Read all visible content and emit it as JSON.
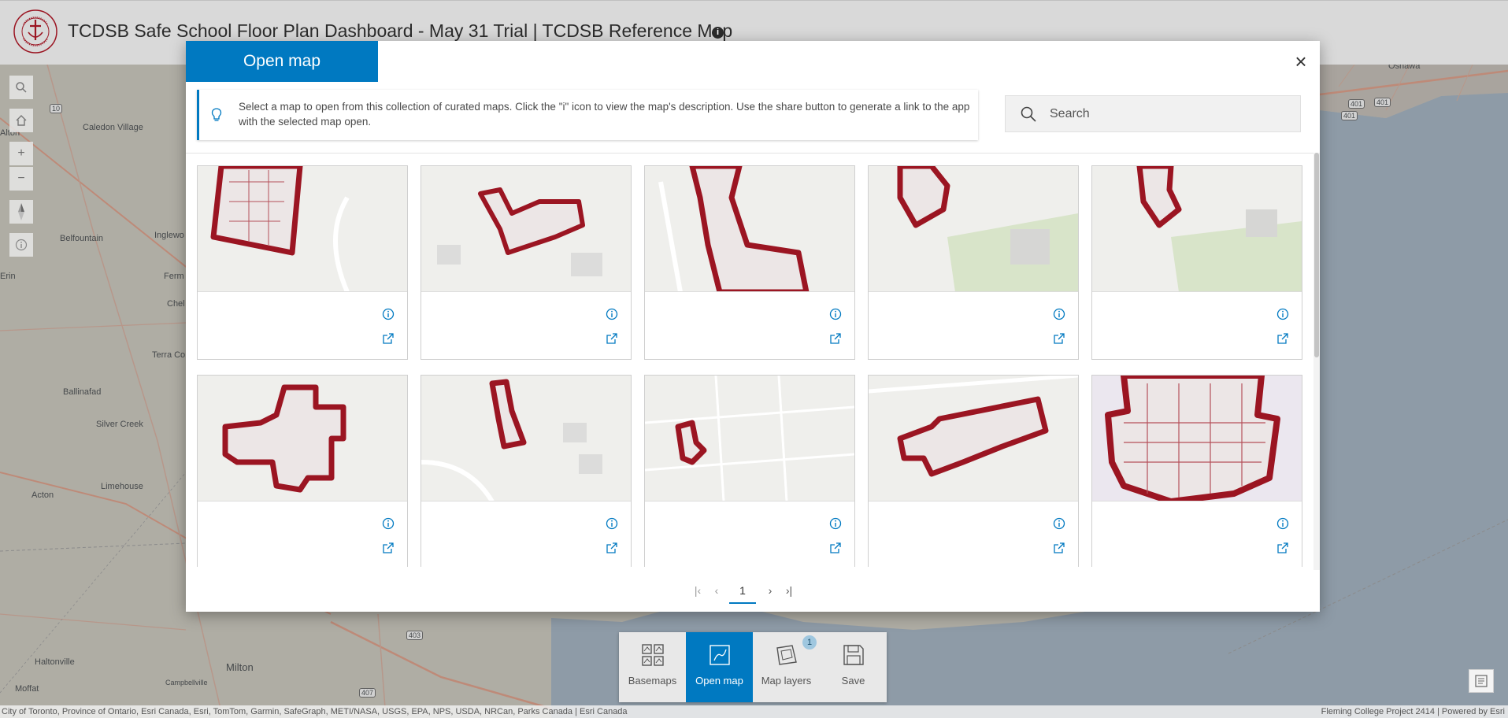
{
  "header": {
    "title": "TCDSB Safe School Floor Plan Dashboard - May 31 Trial | TCDSB Reference Map",
    "info_icon": "info-icon",
    "logo_text_top": "Toronto Catholic",
    "logo_text_bottom": "District School Board"
  },
  "map": {
    "labels": [
      {
        "text": "Oshawa"
      },
      {
        "text": "Caledon Village"
      },
      {
        "text": "Alton"
      },
      {
        "text": "Belfountain"
      },
      {
        "text": "Inglewo"
      },
      {
        "text": "Erin"
      },
      {
        "text": "Ferm"
      },
      {
        "text": "Chel"
      },
      {
        "text": "Terra Co"
      },
      {
        "text": "Ballinafad"
      },
      {
        "text": "Silver Creek"
      },
      {
        "text": "Acton"
      },
      {
        "text": "Limehouse"
      },
      {
        "text": "Haltonville"
      },
      {
        "text": "Milton"
      },
      {
        "text": "Moffat"
      },
      {
        "text": "Campbellville"
      }
    ],
    "shields": [
      "10",
      "401",
      "401",
      "401",
      "403",
      "407"
    ],
    "tools": [
      "search-icon",
      "home-icon",
      "zoom-in-icon",
      "zoom-out-icon",
      "compass-icon",
      "info-icon"
    ]
  },
  "modal": {
    "tab_label": "Open map",
    "close_icon": "close-icon",
    "notice": "Select a map to open from this collection of curated maps. Click the \"i\" icon to view the map's description. Use the share button to generate a link to the app with the selected map open.",
    "search_placeholder": "Search",
    "cards": [
      {
        "title": ""
      },
      {
        "title": ""
      },
      {
        "title": ""
      },
      {
        "title": ""
      },
      {
        "title": ""
      },
      {
        "title": ""
      },
      {
        "title": ""
      },
      {
        "title": ""
      },
      {
        "title": ""
      },
      {
        "title": ""
      }
    ],
    "pager": {
      "current_page": "1"
    }
  },
  "actionbar": {
    "items": [
      {
        "label": "Basemaps",
        "icon": "basemaps-icon"
      },
      {
        "label": "Open map",
        "icon": "open-map-icon",
        "active": true
      },
      {
        "label": "Map layers",
        "icon": "map-layers-icon",
        "badge": "1"
      },
      {
        "label": "Save",
        "icon": "save-icon"
      }
    ]
  },
  "attribution": {
    "left": "City of Toronto, Province of Ontario, Esri Canada, Esri, TomTom, Garmin, SafeGraph, METI/NASA, USGS, EPA, NPS, USDA, NRCan, Parks Canada | Esri Canada",
    "right": "Fleming College Project 2414 | Powered by Esri"
  },
  "colors": {
    "accent": "#0079c1",
    "floorplan": "#9b1522",
    "water": "#aebdcc",
    "land": "#d6d3c9"
  }
}
